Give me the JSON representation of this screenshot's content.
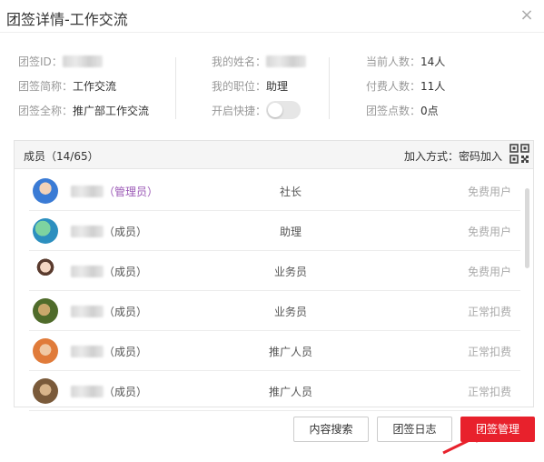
{
  "dialog": {
    "title": "团签详情-工作交流",
    "close_glyph": "×"
  },
  "info": {
    "col1": {
      "id_label": "团签ID：",
      "short_label": "团签简称：",
      "short_value": "工作交流",
      "full_label": "团签全称：",
      "full_value": "推广部工作交流"
    },
    "col2": {
      "name_label": "我的姓名：",
      "position_label": "我的职位：",
      "position_value": "助理",
      "shortcut_label": "开启快捷："
    },
    "col3": {
      "current_label": "当前人数：",
      "current_value": "14人",
      "paid_label": "付费人数：",
      "paid_value": "11人",
      "points_label": "团签点数：",
      "points_value": "0点"
    }
  },
  "members": {
    "header": "成员（14/65）",
    "join_method": "加入方式：密码加入",
    "items": [
      {
        "role": "（管理员）",
        "position": "社长",
        "status": "免费用户",
        "admin": true
      },
      {
        "role": "（成员）",
        "position": "助理",
        "status": "免费用户"
      },
      {
        "role": "（成员）",
        "position": "业务员",
        "status": "免费用户"
      },
      {
        "role": "（成员）",
        "position": "业务员",
        "status": "正常扣费"
      },
      {
        "role": "（成员）",
        "position": "推广人员",
        "status": "正常扣费"
      },
      {
        "role": "（成员）",
        "position": "推广人员",
        "status": "正常扣费"
      }
    ]
  },
  "buttons": {
    "search": "内容搜索",
    "log": "团签日志",
    "manage": "团签管理"
  },
  "colors": {
    "primary": "#e8212c",
    "admin_role": "#9b59b6"
  }
}
